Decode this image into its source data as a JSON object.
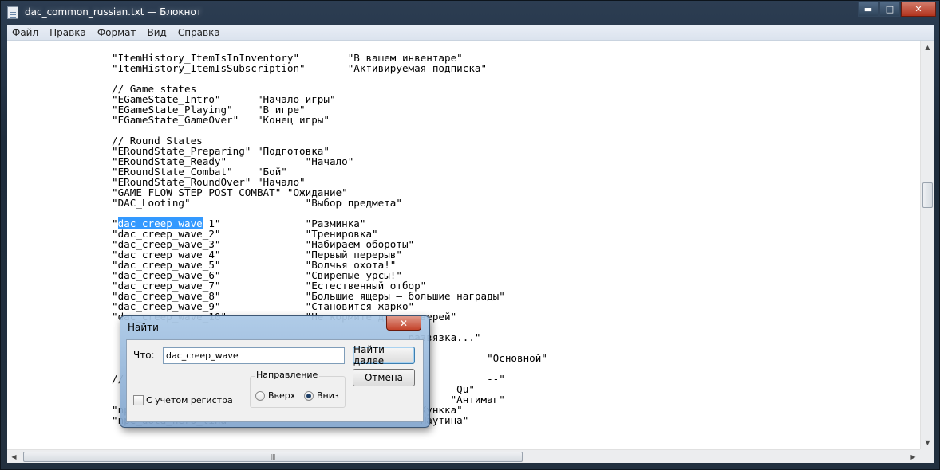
{
  "window": {
    "title": "dac_common_russian.txt — Блокнот",
    "buttons": {
      "minimize": "▬",
      "maximize": "□",
      "close": "✕"
    }
  },
  "menu": [
    "Файл",
    "Правка",
    "Формат",
    "Вид",
    "Справка"
  ],
  "editor": {
    "lines": [
      "\"ItemHistory_ItemIsInInventory\"        \"В вашем инвентаре\"",
      "\"ItemHistory_ItemIsSubscription\"       \"Активируемая подписка\"",
      "",
      "// Game states",
      "\"EGameState_Intro\"      \"Начало игры\"",
      "\"EGameState_Playing\"    \"В игре\"",
      "\"EGameState_GameOver\"   \"Конец игры\"",
      "",
      "// Round States",
      "\"ERoundState_Preparing\" \"Подготовка\"",
      "\"ERoundState_Ready\"             \"Начало\"",
      "\"ERoundState_Combat\"    \"Бой\"",
      "\"ERoundState_RoundOver\" \"Начало\"",
      "\"GAME_FLOW_STEP_POST_COMBAT\" \"Ожидание\"",
      "\"DAC_Looting\"                   \"Выбор предмета\"",
      "",
      "\"dac_creep_wave_1\"              \"Разминка\"",
      "\"dac_creep_wave_2\"              \"Тренировка\"",
      "\"dac_creep_wave_3\"              \"Набираем обороты\"",
      "\"dac_creep_wave_4\"              \"Первый перерыв\"",
      "\"dac_creep_wave_5\"              \"Волчья охота!\"",
      "\"dac_creep_wave_6\"              \"Свирепые урсы!\"",
      "\"dac_creep_wave_7\"              \"Естественный отбор\"",
      "\"dac_creep_wave_8\"              \"Большие ящеры — большие награды\"",
      "\"dac_creep_wave_9\"              \"Становится жарко\"",
      "\"dac_creep_wave_10\"             \"Не кормите диких зверей\"",
      "                                                  \"",
      "                                                 развязка...\"",
      "",
      "                                                              \"Основной\"",
      "",
      "//                                                            --\"",
      "                                                         Qu\"",
      "                                                        \"Антимаг\"",
      "\"npc_dota_hero_kunkka\"                            \"Кункка\"",
      "\"npc_dota_hero_lina\"                              \"Паутина\""
    ],
    "selected": "dac_creep_wave"
  },
  "find_dialog": {
    "title": "Найти",
    "find_label": "Что:",
    "find_value": "dac_creep_wave",
    "find_next": "Найти далее",
    "cancel": "Отмена",
    "direction_label": "Направление",
    "up_label": "Вверх",
    "down_label": "Вниз",
    "direction": "down",
    "match_case_label": "С учетом регистра",
    "match_case": false
  }
}
